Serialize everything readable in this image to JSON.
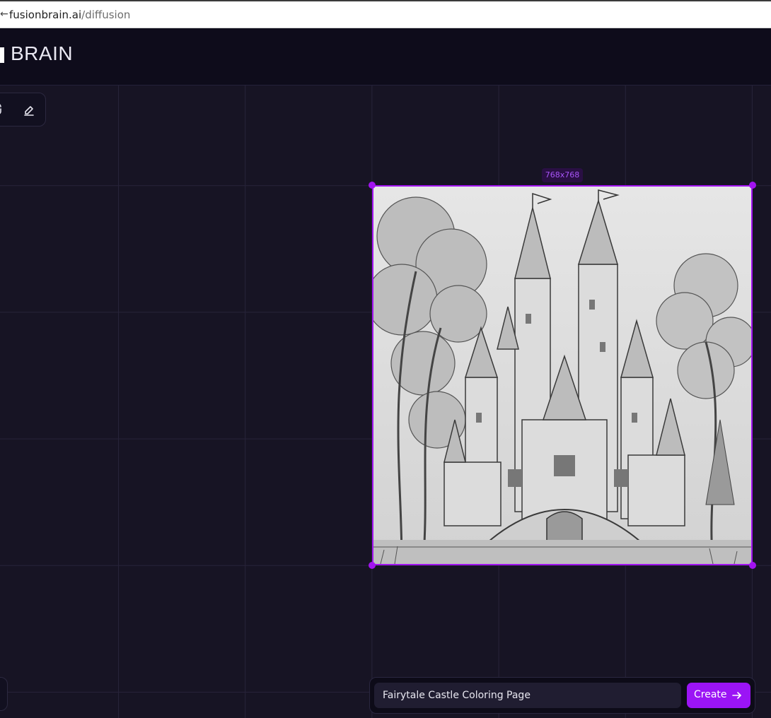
{
  "browser": {
    "url_host": "fusionbrain.ai",
    "url_path": "/diffusion"
  },
  "header": {
    "logo_text": "BRAIN"
  },
  "toolbar": {
    "tools": [
      {
        "icon": "link-icon"
      },
      {
        "icon": "eraser-icon"
      }
    ]
  },
  "canvas_image": {
    "size_label": "768x768",
    "subject": "fairytale castle line drawing"
  },
  "prompt": {
    "value": "Fairytale Castle Coloring Page",
    "create_label": "Create"
  },
  "colors": {
    "accent": "#a213f0",
    "button": "#9b14f5",
    "background": "#171424",
    "header": "#0e0c1b"
  }
}
